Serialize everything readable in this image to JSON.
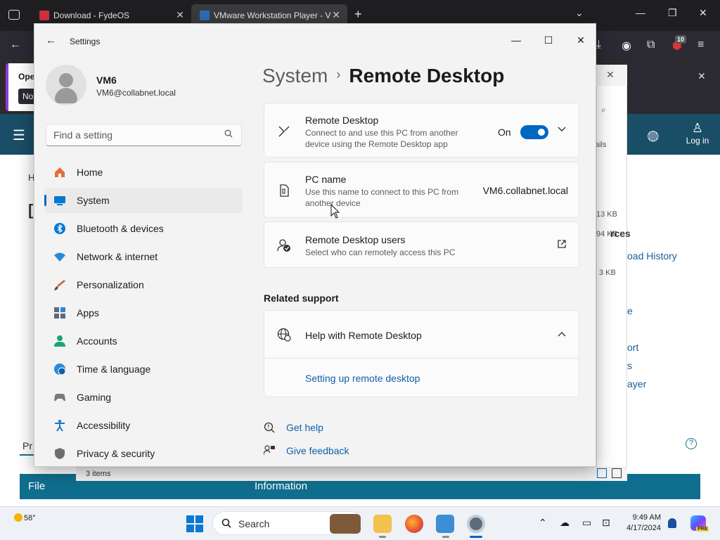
{
  "browser": {
    "tabs": [
      {
        "title": "Download - FydeOS",
        "close": "✕"
      },
      {
        "title": "VMware Workstation Player - V",
        "close": "✕"
      }
    ],
    "new_tab": "+",
    "extension_badge": "10",
    "notice_title": "Oper",
    "notice_button": "No",
    "login_label": "Log in"
  },
  "background_page": {
    "partial_letters": [
      "H",
      "[",
      "Pr"
    ],
    "tab_label": "Pr",
    "table_headers": [
      "File",
      "Information"
    ],
    "sizes": [
      "13 KB",
      "94 KB",
      "3 KB"
    ],
    "side_links": [
      "rces",
      "oad History",
      "e",
      "ort",
      "s",
      "ayer"
    ],
    "explorer_details": "ails",
    "status_items": "3 items"
  },
  "settings": {
    "app_title": "Settings",
    "profile": {
      "name": "VM6",
      "email": "VM6@collabnet.local"
    },
    "search": {
      "placeholder": "Find a setting"
    },
    "nav": [
      {
        "label": "Home",
        "icon": "home-icon",
        "color": "#e36f3b"
      },
      {
        "label": "System",
        "icon": "system-icon",
        "color": "#0078d4",
        "active": true
      },
      {
        "label": "Bluetooth & devices",
        "icon": "bluetooth-icon",
        "color": "#0078d4"
      },
      {
        "label": "Network & internet",
        "icon": "wifi-icon",
        "color": "#2b88d8"
      },
      {
        "label": "Personalization",
        "icon": "brush-icon",
        "color": "#c96b3c"
      },
      {
        "label": "Apps",
        "icon": "apps-icon",
        "color": "#5b6b80"
      },
      {
        "label": "Accounts",
        "icon": "accounts-icon",
        "color": "#1aa37a"
      },
      {
        "label": "Time & language",
        "icon": "globe-clock-icon",
        "color": "#2b88d8"
      },
      {
        "label": "Gaming",
        "icon": "gamepad-icon",
        "color": "#7a7a7a"
      },
      {
        "label": "Accessibility",
        "icon": "accessibility-icon",
        "color": "#1677c9"
      },
      {
        "label": "Privacy & security",
        "icon": "shield-icon",
        "color": "#6e6e6e"
      }
    ],
    "breadcrumb": {
      "parent": "System",
      "separator": "›",
      "current": "Remote Desktop"
    },
    "remote_desktop": {
      "title": "Remote Desktop",
      "description": "Connect to and use this PC from another device using the Remote Desktop app",
      "state_label": "On",
      "enabled": true
    },
    "pc_name": {
      "title": "PC name",
      "description": "Use this name to connect to this PC from another device",
      "value": "VM6.collabnet.local"
    },
    "rd_users": {
      "title": "Remote Desktop users",
      "description": "Select who can remotely access this PC"
    },
    "related_support": {
      "heading": "Related support",
      "help_title": "Help with Remote Desktop",
      "link": "Setting up remote desktop"
    },
    "footer": {
      "get_help": "Get help",
      "give_feedback": "Give feedback"
    }
  },
  "taskbar": {
    "weather": "58°",
    "search_label": "Search",
    "time": "9:49 AM",
    "date": "4/17/2024",
    "copilot_badge": "PRE"
  },
  "colors": {
    "accent": "#0067c0",
    "link": "#0f5fab",
    "site_header": "#1a4d66"
  }
}
